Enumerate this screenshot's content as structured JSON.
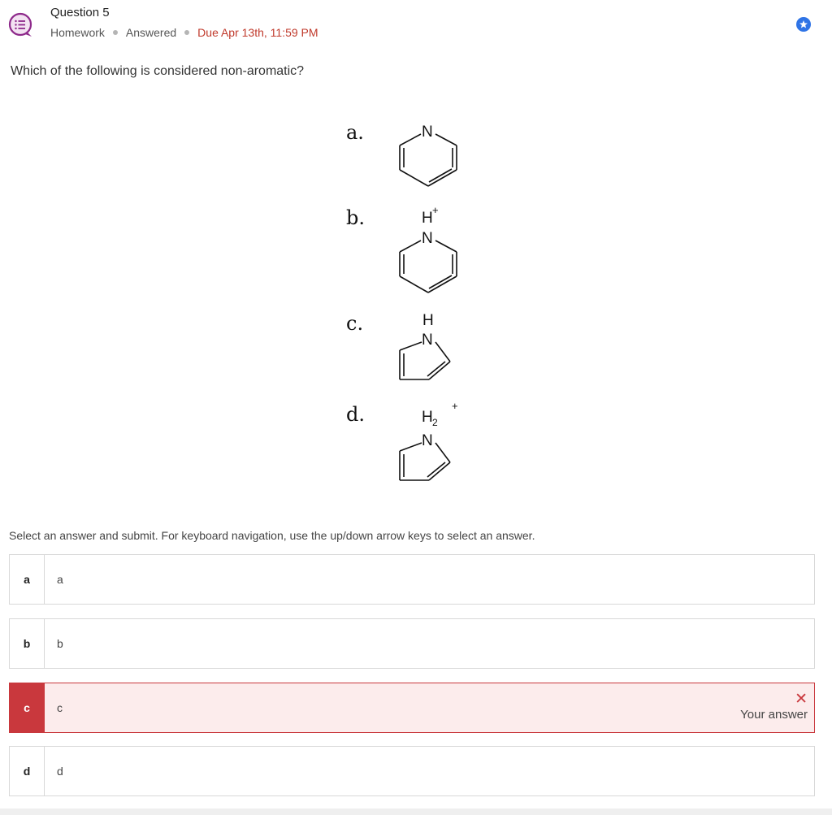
{
  "header": {
    "title": "Question 5",
    "category": "Homework",
    "status": "Answered",
    "due": "Due Apr 13th, 11:59 PM",
    "icon": "chat-list-icon",
    "badge_icon": "star-badge-icon",
    "accent_color": "#8e2a8b",
    "due_color": "#c0392b"
  },
  "question": {
    "text": "Which of the following is considered non-aromatic?",
    "figure": {
      "labels": [
        "a.",
        "b.",
        "c.",
        "d."
      ],
      "atoms": {
        "a": [
          "N"
        ],
        "b": [
          "H",
          "+",
          "N"
        ],
        "c": [
          "H",
          "N"
        ],
        "d": [
          "H",
          "2",
          "+",
          "N"
        ]
      }
    }
  },
  "instructions": "Select an answer and submit. For keyboard navigation, use the up/down arrow keys to select an answer.",
  "options": [
    {
      "letter": "a",
      "text": "a"
    },
    {
      "letter": "b",
      "text": "b"
    },
    {
      "letter": "c",
      "text": "c",
      "feedback": "Your answer",
      "state": "incorrect"
    },
    {
      "letter": "d",
      "text": "d"
    }
  ],
  "colors": {
    "incorrect": "#c9383d",
    "incorrect_bg": "#fcecec",
    "badge": "#2f74e6"
  }
}
